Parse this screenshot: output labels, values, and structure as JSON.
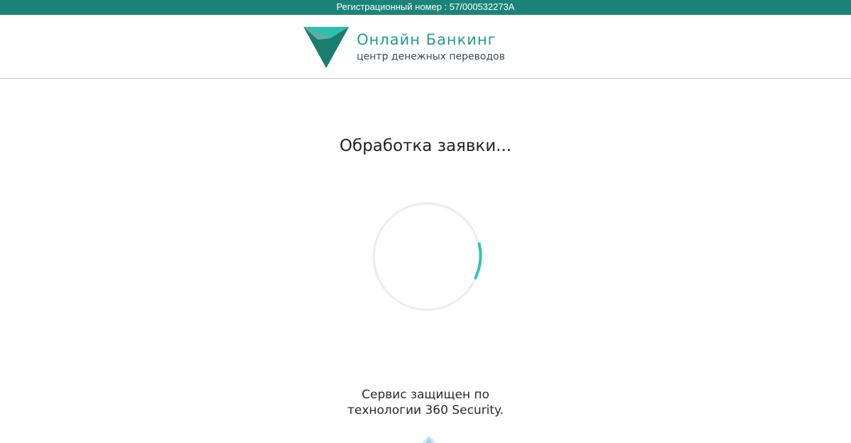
{
  "topbar": {
    "registration_text": "Регистрационный номер : 57/000532273A"
  },
  "header": {
    "logo": {
      "title": "Онлайн Банкинг",
      "subtitle": "центр денежных переводов",
      "colors": {
        "primary": "#1f9d91",
        "dark": "#1b7c70",
        "light": "#2cc0ae"
      }
    }
  },
  "main": {
    "status_text": "Обработка заявки...",
    "spinner": {
      "icon": "loading-spinner-icon",
      "track_color": "#ececec",
      "arc_color": "#2ec5b1"
    }
  },
  "footer": {
    "security_line1": "Сервис защищен по",
    "security_line2": "технологии 360 Security.",
    "security_icon": "shield-icon"
  },
  "colors": {
    "topbar_bg": "#1b8478",
    "page_bg": "#ffffff",
    "divider": "#c9c9c9"
  }
}
